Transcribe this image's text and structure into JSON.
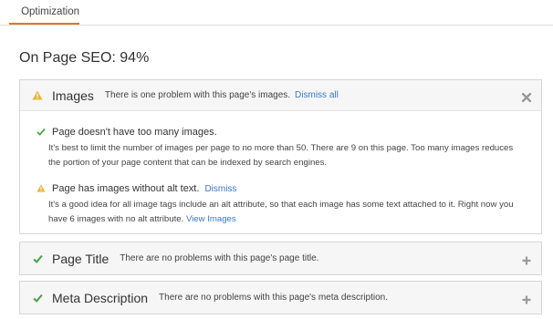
{
  "tab": {
    "label": "Optimization",
    "icon": "pulse-icon",
    "accent": "#e8761e"
  },
  "summary": {
    "title": "On Page SEO: 94%"
  },
  "colors": {
    "warning": "#e9b73a",
    "success": "#4aa44a",
    "link": "#3a78c2",
    "control": "#9a9a9a"
  },
  "sections": {
    "images": {
      "title": "Images",
      "message": "There is one problem with this page's images.",
      "action": "Dismiss all",
      "status": "warning",
      "expanded": true,
      "items": [
        {
          "status": "ok",
          "title": "Page doesn't have too many images.",
          "description": "It's best to limit the number of images per page to no more than 50. There are 9 on this page. Too many images reduces the portion of your page content that can be indexed by search engines."
        },
        {
          "status": "warning",
          "title": "Page has images without alt text.",
          "action": "Dismiss",
          "description": "It's a good idea for all image tags include an alt attribute, so that each image has some text attached to it. Right now you have 6 images with no alt attribute.",
          "link": "View Images"
        }
      ]
    },
    "page_title": {
      "title": "Page Title",
      "message": "There are no problems with this page's page title.",
      "status": "ok",
      "expanded": false
    },
    "meta_description": {
      "title": "Meta Description",
      "message": "There are no problems with this page's meta description.",
      "status": "ok",
      "expanded": false
    }
  }
}
